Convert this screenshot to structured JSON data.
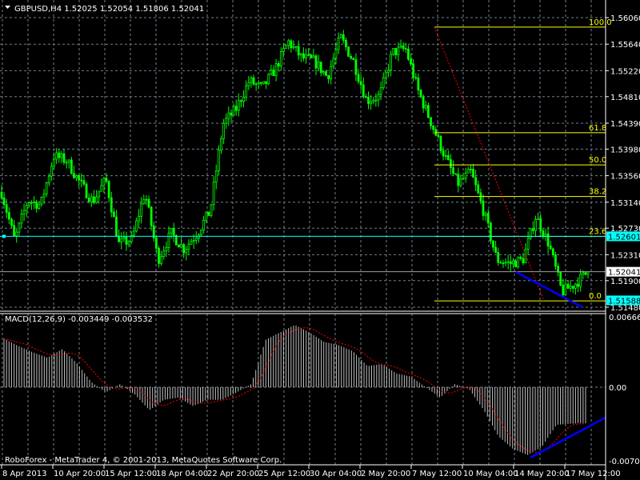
{
  "header": {
    "symbol": "GBPUSD,H4",
    "open": "1.52025",
    "high": "1.52054",
    "low": "1.51806",
    "close": "1.52041"
  },
  "footer": {
    "copyright": "RoboForex - MetaTrader 4, © 2001-2013, MetaQuotes Software Corp."
  },
  "colors": {
    "background": "#000000",
    "bull": "#00ff00",
    "bear": "#00ff00",
    "grid": "#708090",
    "fib": "#ffff00",
    "current_price": "#00ffff",
    "trendline": "#0000ff",
    "macd_hist": "#c0c0c0",
    "macd_signal": "#ff0000"
  },
  "chart_data": [
    {
      "type": "candlestick",
      "title": "GBPUSD,H4",
      "ylim": [
        1.5148,
        1.5606
      ],
      "grid": true,
      "y_ticks": [
        "1.56060",
        "1.55640",
        "1.55220",
        "1.54810",
        "1.54390",
        "1.53980",
        "1.53560",
        "1.53140",
        "1.52730",
        "1.52310",
        "1.51900",
        "1.51480"
      ],
      "x_ticks": [
        "8 Apr 2013",
        "10 Apr 20:00",
        "15 Apr 12:00",
        "18 Apr 04:00",
        "22 Apr 20:00",
        "25 Apr 12:00",
        "30 Apr 04:00",
        "2 May 20:00",
        "7 May 12:00",
        "10 May 04:00",
        "14 May 20:00",
        "17 May 12:00"
      ],
      "approx_close_path": [
        1.533,
        1.5254,
        1.5317,
        1.531,
        1.5387,
        1.538,
        1.5345,
        1.5315,
        1.535,
        1.5248,
        1.5255,
        1.533,
        1.5223,
        1.5265,
        1.524,
        1.5265,
        1.53,
        1.5438,
        1.5462,
        1.5506,
        1.5494,
        1.5525,
        1.5568,
        1.5543,
        1.5537,
        1.5512,
        1.5575,
        1.5537,
        1.5475,
        1.5482,
        1.5551,
        1.5557,
        1.5488,
        1.5438,
        1.5387,
        1.5343,
        1.5362,
        1.5299,
        1.5223,
        1.5217,
        1.5223,
        1.5292,
        1.5248,
        1.5172,
        1.5185,
        1.5204
      ],
      "price_labels": {
        "cyan_line": "1.52601",
        "last_price": "1.52041",
        "fib_low": "1.51588"
      },
      "fibonacci": {
        "levels": [
          "100.0",
          "61.8",
          "50.0",
          "38.2",
          "23.6",
          "0.0"
        ],
        "prices": [
          1.5591,
          1.5424,
          1.5373,
          1.5323,
          1.526,
          1.5158
        ]
      },
      "current_price_line": 1.52601,
      "last_price": 1.52041
    },
    {
      "type": "bar",
      "title": "MACD(12,26,9)",
      "label": "MACD(12,26,9) -0.003449 -0.003532",
      "ylim": [
        -0.007049,
        0.006666
      ],
      "y_ticks": [
        "0.006666",
        "0.00",
        "-0.007049"
      ],
      "macd_path": [
        0.0046,
        0.0039,
        0.0033,
        0.0028,
        0.0036,
        0.0023,
        0.0005,
        -0.0005,
        0.0003,
        -0.0007,
        -0.0022,
        -0.0012,
        -0.001,
        -0.0018,
        -0.0012,
        -0.0012,
        -0.0005,
        0.0003,
        0.0045,
        0.0052,
        0.0059,
        0.0052,
        0.0043,
        0.004,
        0.0034,
        0.002,
        0.0022,
        0.0013,
        0.001,
        0.0,
        -0.001,
        0.0003,
        -0.0002,
        -0.0022,
        -0.0047,
        -0.0059,
        -0.0065,
        -0.0057,
        -0.0036,
        -0.0035,
        -0.0034
      ],
      "macd_last": -0.003449,
      "signal_last": -0.003532
    }
  ]
}
